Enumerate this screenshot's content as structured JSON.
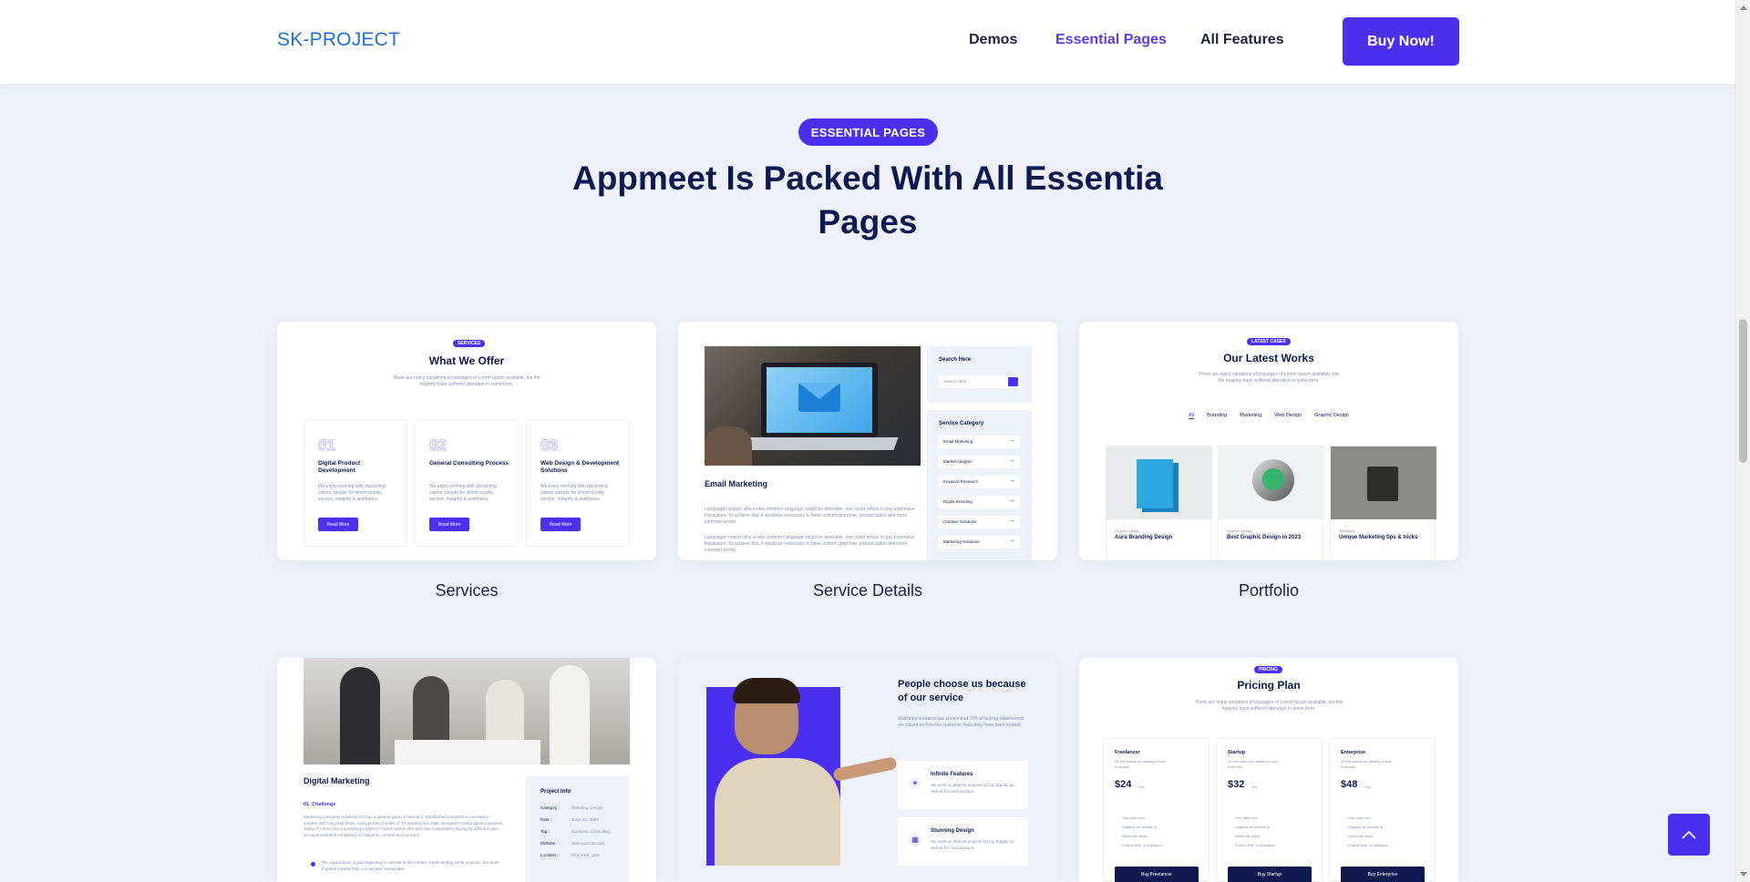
{
  "header": {
    "logo": "SK-PROJECT",
    "nav": [
      {
        "label": "Demos"
      },
      {
        "label": "Essential Pages"
      },
      {
        "label": "All Features"
      }
    ],
    "buy_label": "Buy Now!"
  },
  "section": {
    "badge": "ESSENTIAL PAGES",
    "title": "Appmeet Is Packed With All Essentia Pages"
  },
  "cards": [
    {
      "label": "Services",
      "preview": {
        "badge": "SERVICES",
        "title": "What We Offer",
        "desc": "There are many variations of passages of Lorem Ipsum available, but the majority have suffered alteration in some form.",
        "items": [
          {
            "num": "01",
            "title": "Digital Product Development",
            "text": "We enjoy working with discerning clients, people for whom quality, service, integrity & aesthetics.",
            "btn": "Read More"
          },
          {
            "num": "02",
            "title": "General Consulting Process",
            "text": "We enjoy working with discerning clients, people for whom quality, service, integrity & aesthetics.",
            "btn": "Read More"
          },
          {
            "num": "03",
            "title": "Web Design & Development Solutions",
            "text": "We enjoy working with discerning clients, people for whom quality, service, integrity & aesthetics.",
            "btn": "Read More"
          }
        ]
      }
    },
    {
      "label": "Service Details",
      "preview": {
        "title": "Email Marketing",
        "text": "Languages realize who a new common language would be desirable: one could refuse to pay expensive translators. To achieve this, it would be necessary to have uniform grammar, pronunciation and more common words.",
        "search_title": "Search Here",
        "search_placeholder": "Search Here...",
        "category_title": "Service Category",
        "categories": [
          "Email Marketing",
          "Market Analysis",
          "Keyword Research",
          "Digital Branding",
          "Creative Solutions",
          "Marketing Solutions"
        ]
      }
    },
    {
      "label": "Portfolio",
      "preview": {
        "badge": "LATEST CASES",
        "title": "Our Latest Works",
        "desc": "There are many variations of passages of Lorem Ipsum available, but the majority have suffered alteration in some form.",
        "filters": [
          "All",
          "Branding",
          "Marketing",
          "Web Design",
          "Graphic Design"
        ],
        "works": [
          {
            "cat": "Graphic Design",
            "name": "Aura Branding Design"
          },
          {
            "cat": "Graphic Design",
            "name": "Best Graphic Design in 2023"
          },
          {
            "cat": "Marketing",
            "name": "Unique Marketing tips & tricks"
          }
        ]
      }
    },
    {
      "label": "",
      "preview": {
        "title": "Digital Marketing",
        "challenge": "01. Challenge",
        "text": "Marketing consumer products fort has a gentest game of twentent, Established competition invested in creative with long lead times, using proven models of TV winning few retail, alongside trusted agency partners. Today, it's more like a sprawling contest of mixed marine arts with new competitors playing by different rules, an unprecedented complexity of channels, content and partners.",
        "bullet": "The organization is just beginning to operate in the market, implementing some projects. Our team of global experts help you achieve sustainable.",
        "info_title": "Project Info",
        "info": [
          {
            "k": "Category :",
            "v": "Branding, Design"
          },
          {
            "k": "Date :",
            "v": "June, 21, 2023"
          },
          {
            "k": "Tag :",
            "v": "Business, Consulting"
          },
          {
            "k": "Website :",
            "v": "www.yoursite.com"
          },
          {
            "k": "Location :",
            "v": "New York, USA"
          }
        ]
      }
    },
    {
      "label": "",
      "preview": {
        "title": "People choose us because of our service",
        "desc": "Multilatey research has shown that 70% of buying experiences are based on how the customer feels they have been treated.",
        "features": [
          {
            "title": "Infinite Features",
            "text": "We work on diverse projects for top brands as well as for cool startups."
          },
          {
            "title": "Stunning Design",
            "text": "We work on diverse projects for top brands as well as for cool startups."
          }
        ]
      }
    },
    {
      "label": "",
      "preview": {
        "badge": "PRICING",
        "title": "Pricing Plan",
        "desc": "There are many variations of passages of Lorem Ipsum available, but the majority have suffered alteration in some form.",
        "plans": [
          {
            "name": "Freelancer",
            "sub": "All the basics for starting a new business",
            "price": "$24",
            "per": "/mo",
            "features": [
              "One patio slot",
              "Sagittus ac facilisis in.",
              "World tax issue.",
              "Potenti felis, in vestigium."
            ],
            "btn": "Buy Freelancer"
          },
          {
            "name": "Startup",
            "sub": "All the basics for starting a new business",
            "price": "$32",
            "per": "/mo",
            "features": [
              "One patio slot",
              "Sagittus ac facilisis in.",
              "World tax issue.",
              "Potenti felis, in vestigium."
            ],
            "btn": "Buy Startup"
          },
          {
            "name": "Enterprise",
            "sub": "All the basics for starting a new business",
            "price": "$48",
            "per": "/mo",
            "features": [
              "One patio slot",
              "Sagittus ac facilisis in.",
              "World tax issue.",
              "Potenti felis, in vestigium."
            ],
            "btn": "Buy Enterprise"
          }
        ]
      }
    }
  ],
  "icons": {
    "back_to_top": "chevron-up-icon",
    "search": "search-icon",
    "arrow": "arrow-right-icon"
  },
  "colors": {
    "accent": "#4d2ff0",
    "dark": "#0e1a4f",
    "link": "#1f6fd6",
    "background": "#eef1fa"
  }
}
